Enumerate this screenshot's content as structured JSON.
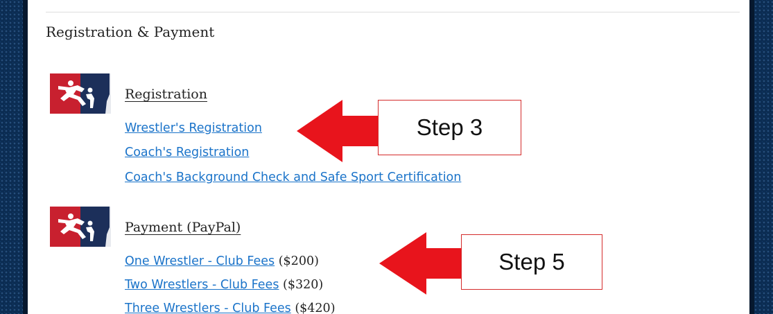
{
  "section": {
    "title": "Registration & Payment"
  },
  "groups": [
    {
      "heading": "Registration",
      "links": [
        {
          "label": "Wrestler's Registration"
        },
        {
          "label": "Coach's Registration"
        },
        {
          "label": "Coach's Background Check and Safe Sport Certification"
        }
      ]
    },
    {
      "heading": "Payment (PayPal)",
      "links": [
        {
          "label": "One Wrestler - Club Fees",
          "price": "($200)"
        },
        {
          "label": "Two Wrestlers - Club Fees",
          "price": "($320)"
        },
        {
          "label": "Three Wrestlers - Club Fees",
          "price": "($420)"
        }
      ]
    }
  ],
  "callouts": [
    {
      "label": "Step 3"
    },
    {
      "label": "Step 5"
    }
  ],
  "colors": {
    "link": "#1a73c9",
    "arrow": "#e8141c",
    "logo_red": "#c8202f",
    "logo_navy": "#1c2f5a",
    "page_border": "#0b2c52"
  },
  "icons": {
    "logo": "wrestler-logo-icon",
    "arrow": "left-arrow-icon"
  }
}
